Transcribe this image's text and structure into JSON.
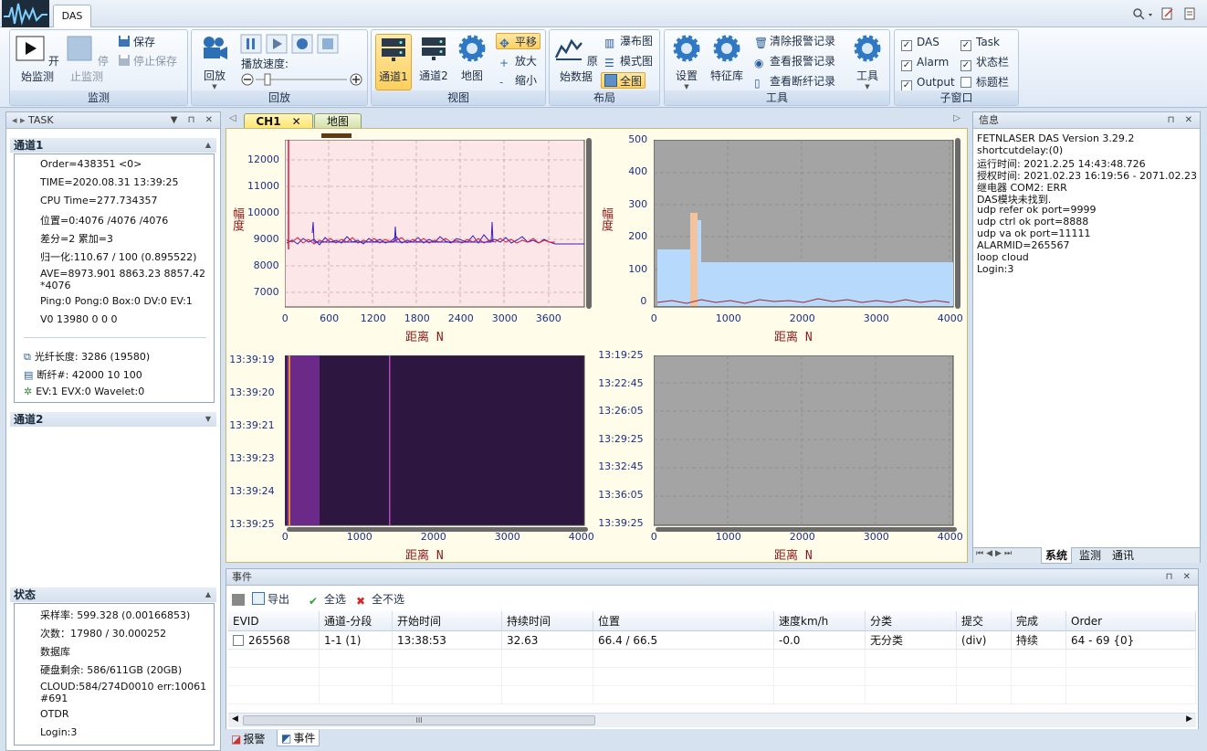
{
  "ribbon": {
    "tab": "DAS",
    "groups": {
      "monitor": {
        "label": "监测",
        "start": "开始监测",
        "stop": "停止监测",
        "save": "保存",
        "stop_save": "停止保存"
      },
      "playback": {
        "label": "回放",
        "replay": "回放",
        "speed_label": "播放速度:"
      },
      "view": {
        "label": "视图",
        "ch1": "通道1",
        "ch2": "通道2",
        "map": "地图",
        "pan": "平移",
        "zoom_in": "放大",
        "zoom_out": "缩小"
      },
      "layout": {
        "label": "布局",
        "raw": "原始数据",
        "waterfall": "瀑布图",
        "pattern": "模式图",
        "full": "全图"
      },
      "tools": {
        "label": "工具",
        "settings": "设置",
        "features": "特征库",
        "clear_alarm": "清除报警记录",
        "view_alarm": "查看报警记录",
        "view_break": "查看断纤记录",
        "tools": "工具"
      },
      "subwin": {
        "label": "子窗口",
        "das": "DAS",
        "task": "Task",
        "alarm": "Alarm",
        "statusbar": "状态栏",
        "output": "Output",
        "titlebar": "标题栏"
      }
    }
  },
  "task_panel": {
    "title": "TASK",
    "channel1": {
      "title": "通道1",
      "lines": [
        "Order=438351   <0>",
        "TIME=2020.08.31 13:39:25",
        "CPU Time=277.734357",
        "位置=0:4076 /4076 /4076",
        "差分=2 累加=3",
        "归一化:110.67 / 100 (0.895522)",
        "AVE=8973.901 8863.23 8857.42",
        "*4076",
        "Ping:0 Pong:0 Box:0 DV:0 EV:1",
        "V0 13980 0 0 0"
      ],
      "fiber_len": "光纤长度: 3286 (19580)",
      "break": "断纤#: 42000 10 100",
      "ev": "EV:1 EVX:0 Wavelet:0"
    },
    "channel2": {
      "title": "通道2"
    },
    "status": {
      "title": "状态",
      "lines": [
        "采样率: 599.328 (0.00166853)",
        "次数：17980 / 30.000252",
        "数据库",
        "硬盘剩余: 586/611GB (20GB)",
        "CLOUD:584/274D0010 err:10061",
        "#691",
        "OTDR",
        "Login:3"
      ]
    }
  },
  "doc_tabs": {
    "ch1": "CH1",
    "map": "地图"
  },
  "plots": {
    "ylabel": "幅度",
    "xlabel": "距离 N",
    "p1": {
      "yticks": [
        "12000",
        "11000",
        "10000",
        "9000",
        "8000",
        "7000"
      ],
      "xticks": [
        "0",
        "600",
        "1200",
        "1800",
        "2400",
        "3000",
        "3600"
      ]
    },
    "p2": {
      "yticks": [
        "500",
        "400",
        "300",
        "200",
        "100",
        "0"
      ],
      "xticks": [
        "0",
        "1000",
        "2000",
        "3000",
        "4000"
      ]
    },
    "p3": {
      "yticks": [
        "13:39:19",
        "13:39:20",
        "13:39:21",
        "13:39:23",
        "13:39:24",
        "13:39:25"
      ],
      "xticks": [
        "0",
        "1000",
        "2000",
        "3000",
        "4000"
      ]
    },
    "p4": {
      "yticks": [
        "13:19:25",
        "13:22:45",
        "13:26:05",
        "13:29:25",
        "13:32:45",
        "13:36:05",
        "13:39:25"
      ],
      "xticks": [
        "0",
        "1000",
        "2000",
        "3000",
        "4000"
      ]
    }
  },
  "info_panel": {
    "title": "信息",
    "lines": [
      "FETNLASER DAS Version 3.29.2",
      "shortcutdelay:(0)",
      "运行时间: 2021.2.25 14:43:48.726",
      "授权时间: 2021.02.23 16:19:56 - 2071.02.23 16:19",
      "继电器 COM2: ERR",
      "DAS模块未找到.",
      "udp refer ok port=9999",
      "udp ctrl ok port=8888",
      "udp va ok port=11111",
      "ALARMID=265567",
      "loop cloud",
      "Login:3"
    ],
    "tabs": [
      "系统",
      "监测",
      "通讯"
    ]
  },
  "events": {
    "title": "事件",
    "toolbar": {
      "export": "导出",
      "select_all": "全选",
      "select_none": "全不选"
    },
    "columns": [
      "EVID",
      "通道-分段",
      "开始时间",
      "持续时间",
      "位置",
      "速度km/h",
      "分类",
      "提交",
      "完成",
      "Order"
    ],
    "rows": [
      [
        "265568",
        "1-1 (1)",
        "13:38:53",
        "32.63",
        "66.4 / 66.5",
        "-0.0",
        "无分类",
        "(div)",
        "持续",
        "64 - 69 {0}"
      ]
    ],
    "scroll_mark": "III"
  },
  "bottom_tabs": {
    "alarm": "报警",
    "event": "事件"
  }
}
